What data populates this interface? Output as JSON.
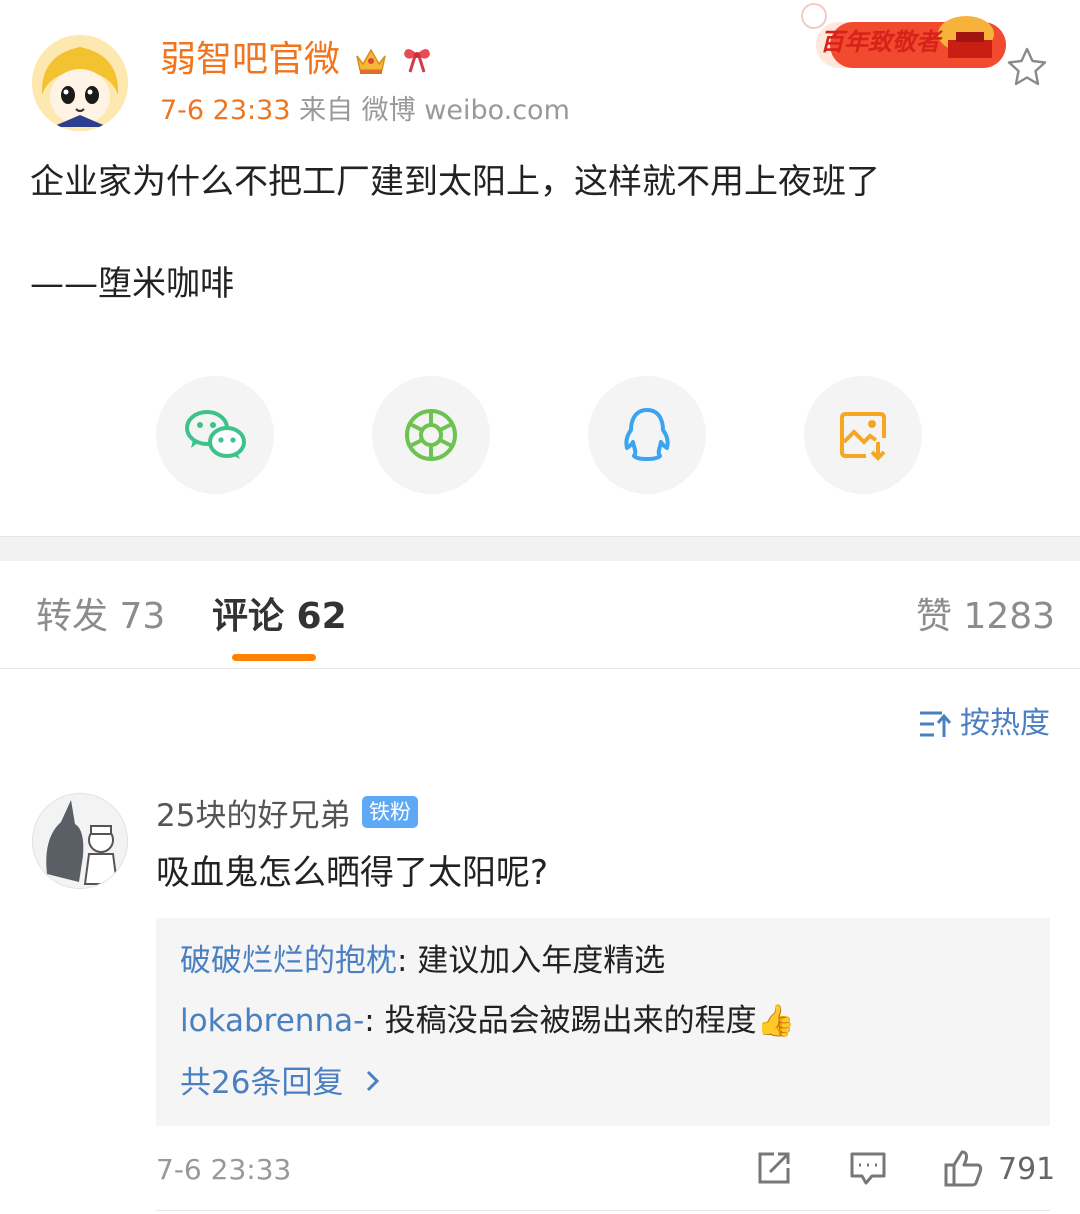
{
  "post": {
    "author": "弱智吧官微",
    "time": "7-6 23:33",
    "source": " 来自 微博 weibo.com",
    "text": "企业家为什么不把工厂建到太阳上，这样就不用上夜班了",
    "signature": "——堕米咖啡",
    "anniversary_badge": "百年致敬者",
    "share_icons": [
      "wechat-icon",
      "moments-icon",
      "qq-icon",
      "save-image-icon"
    ]
  },
  "tabs": {
    "repost": "转发 73",
    "comments": "评论 62",
    "likes": "赞 1283"
  },
  "sort_label": "按热度",
  "comment": {
    "user": "25块的好兄弟",
    "badge": "铁粉",
    "text": "吸血鬼怎么晒得了太阳呢?",
    "replies": [
      {
        "user": "破破烂烂的抱枕",
        "text": ": 建议加入年度精选"
      },
      {
        "user": "lokabrenna-",
        "text": ": 投稿没品会被踢出来的程度👍"
      }
    ],
    "more_replies": "共26条回复",
    "time": "7-6 23:33",
    "like_count": "791"
  },
  "colors": {
    "accent": "#ff8200",
    "name_orange": "#f0751e",
    "link_blue": "#4a7fc1"
  }
}
